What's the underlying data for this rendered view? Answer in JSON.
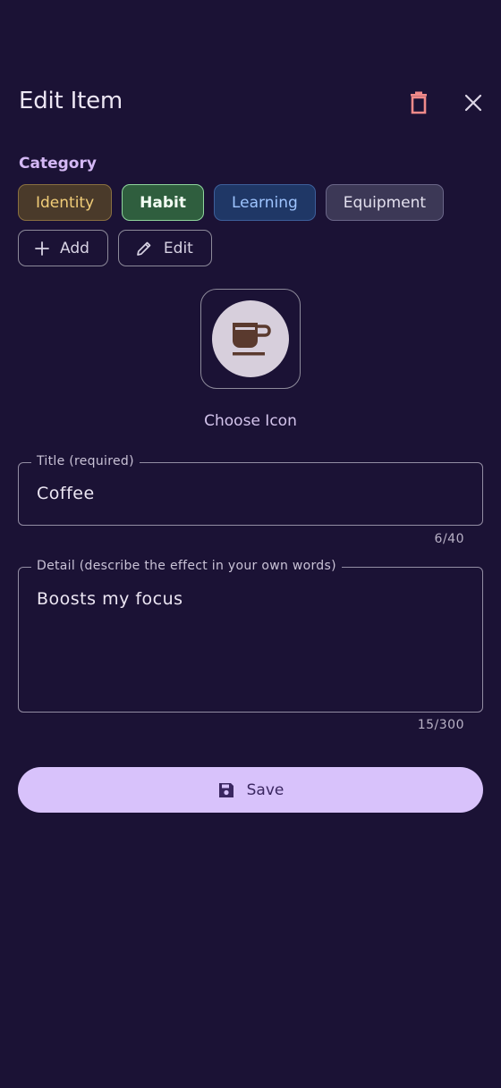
{
  "header": {
    "title": "Edit Item"
  },
  "category": {
    "label": "Category",
    "chips": [
      {
        "label": "Identity"
      },
      {
        "label": "Habit"
      },
      {
        "label": "Learning"
      },
      {
        "label": "Equipment"
      }
    ],
    "selected": "Habit",
    "add_label": "Add",
    "edit_label": "Edit"
  },
  "icon_chooser": {
    "icon": "coffee-cup-icon",
    "label": "Choose Icon"
  },
  "title_field": {
    "label": "Title (required)",
    "value": "Coffee",
    "counter": "6/40"
  },
  "detail_field": {
    "label": "Detail (describe the effect in your own words)",
    "value": "Boosts my focus",
    "counter": "15/300"
  },
  "save": {
    "label": "Save",
    "icon": "save-icon"
  },
  "colors": {
    "background": "#1b1235",
    "accent": "#d8c2fb",
    "delete": "#f08a8a"
  }
}
